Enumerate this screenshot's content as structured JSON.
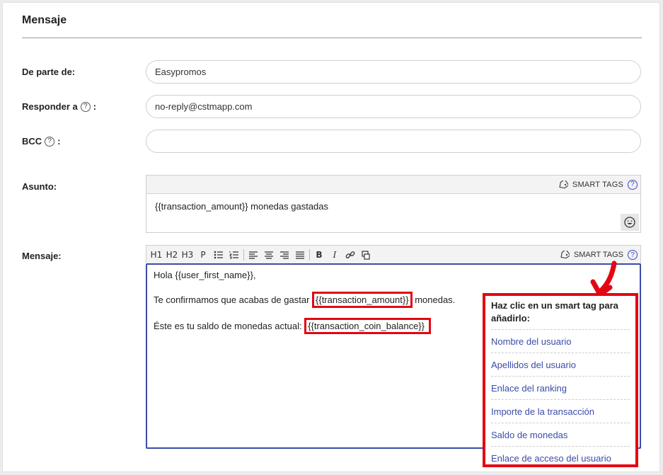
{
  "section": {
    "title": "Mensaje"
  },
  "from": {
    "label": "De parte de:",
    "value": "Easypromos"
  },
  "reply_to": {
    "label": "Responder a",
    "help": "?",
    "colon": ":",
    "value": "no-reply@cstmapp.com"
  },
  "bcc": {
    "label": "BCC",
    "help": "?",
    "colon": ":",
    "value": ""
  },
  "subject": {
    "label": "Asunto:",
    "smart_tags": "SMART TAGS",
    "help": "?",
    "value": "{{transaction_amount}} monedas gastadas"
  },
  "message": {
    "label": "Mensaje:",
    "smart_tags": "SMART TAGS",
    "help": "?",
    "toolbar": {
      "h1": "H1",
      "h2": "H2",
      "h3": "H3",
      "p": "P",
      "bold": "B",
      "italic": "I"
    },
    "line1": "Hola {{user_first_name}},",
    "line2_before": "Te confirmamos que acabas de gastar ",
    "line2_tag": "{{transaction_amount}}",
    "line2_after": " monedas.",
    "line3_before": "Éste es tu saldo de monedas actual: ",
    "line3_tag": "{{transaction_coin_balance}}"
  },
  "smart_tag_popup": {
    "header": "Haz clic en un smart tag para añadirlo:",
    "items": [
      "Nombre del usuario",
      "Apellidos del usuario",
      "Enlace del ranking",
      "Importe de la transacción",
      "Saldo de monedas",
      "Enlace de acceso del usuario"
    ]
  },
  "colors": {
    "highlight": "#e30613",
    "link": "#3a4ca8"
  }
}
